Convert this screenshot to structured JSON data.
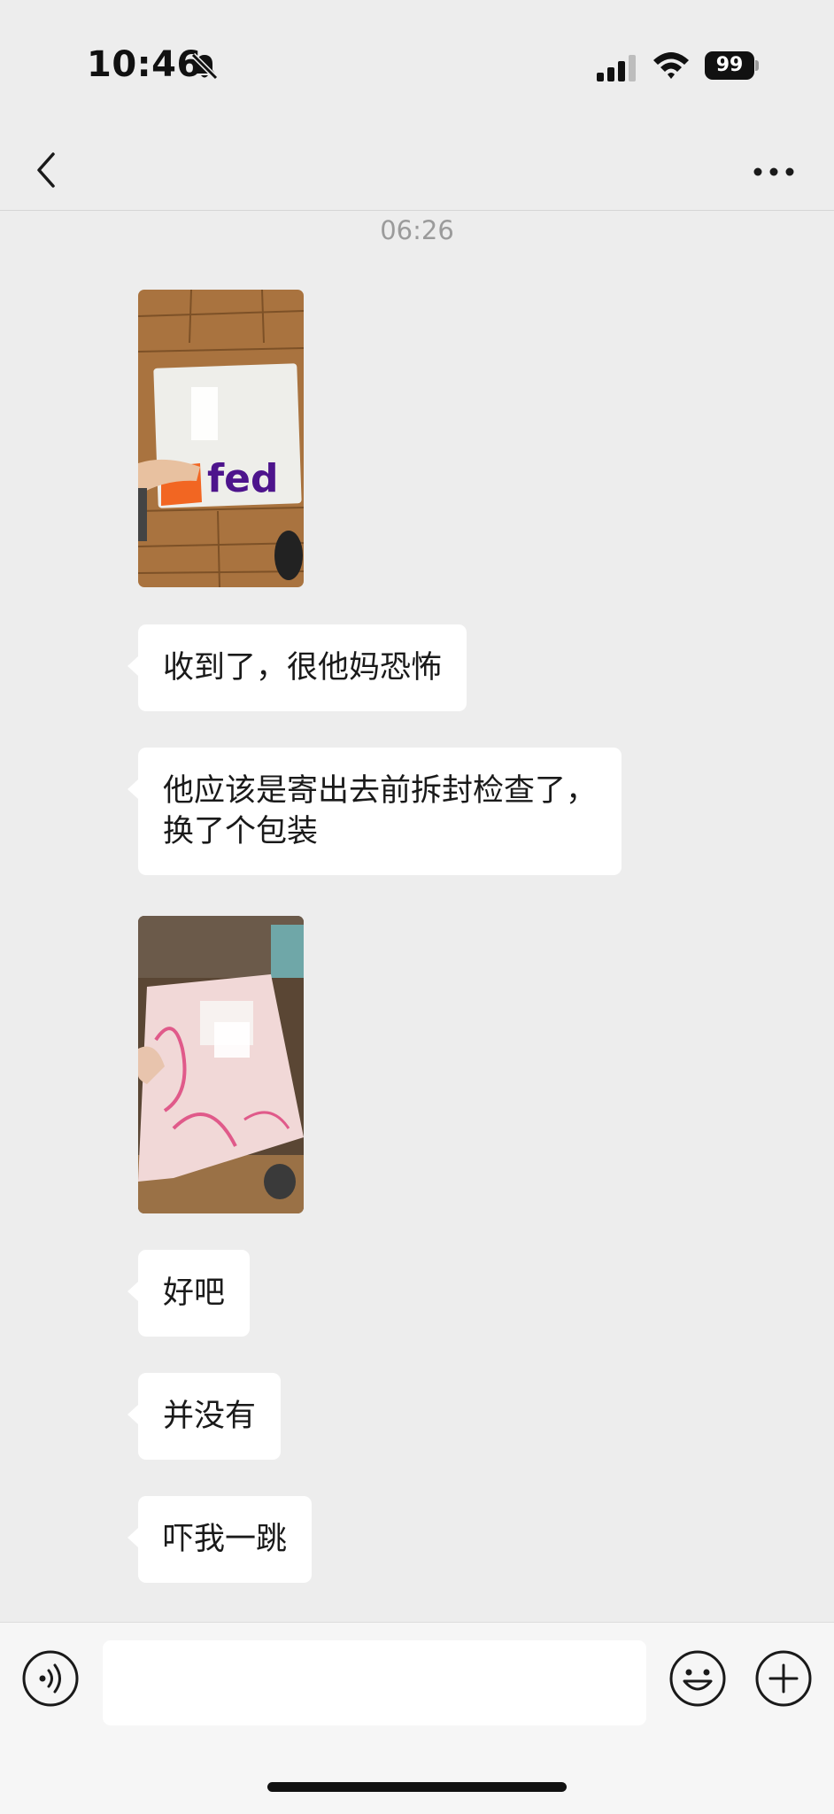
{
  "status_bar": {
    "time": "10:46",
    "battery": "99",
    "icons": [
      "bell-slash-icon",
      "signal-icon",
      "wifi-icon",
      "battery-icon"
    ]
  },
  "nav": {
    "back_icon": "chevron-left-icon",
    "more_icon": "ellipsis-icon"
  },
  "chat": {
    "timestamp": "06:26",
    "messages": [
      {
        "type": "image",
        "description_icon": "photo-icon"
      },
      {
        "type": "text",
        "text": "收到了，很他妈恐怖"
      },
      {
        "type": "text",
        "lines": [
          "他应该是寄出去前拆封检查了，",
          "换了个包装"
        ]
      },
      {
        "type": "image",
        "description_icon": "photo-icon"
      },
      {
        "type": "text",
        "text": "好吧"
      },
      {
        "type": "text",
        "text": "并没有"
      },
      {
        "type": "text",
        "text": "吓我一跳"
      }
    ]
  },
  "input_bar": {
    "voice_icon": "voice-icon",
    "emoji_icon": "emoji-icon",
    "plus_icon": "plus-icon",
    "message_value": ""
  },
  "colors": {
    "background": "#ededed",
    "bubble": "#ffffff",
    "timestamp": "#9b9b9b",
    "input_bar": "#f6f6f6"
  }
}
